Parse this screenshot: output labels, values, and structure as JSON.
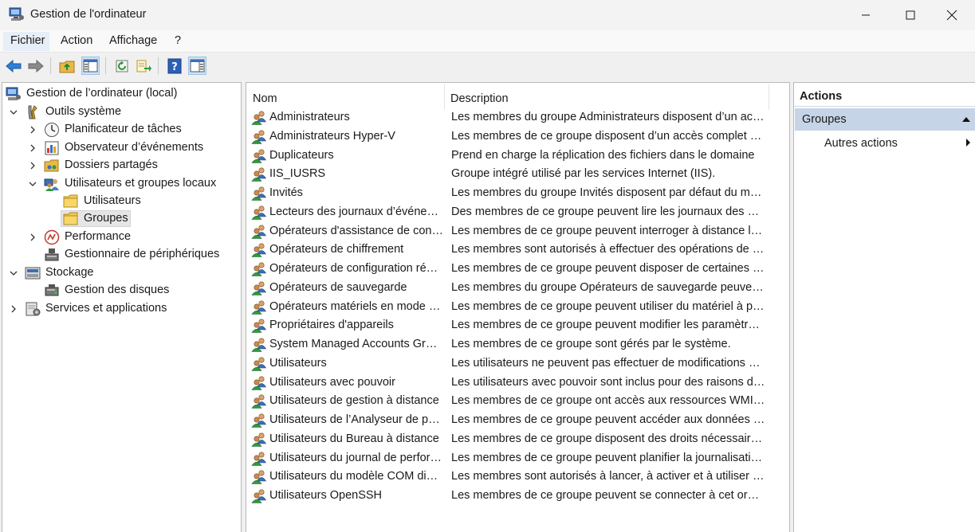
{
  "window": {
    "title": "Gestion de l'ordinateur",
    "controls": [
      "minimize",
      "maximize",
      "close"
    ]
  },
  "menu": [
    "Fichier",
    "Action",
    "Affichage",
    "?"
  ],
  "toolbar": {
    "buttons": [
      "back-icon",
      "forward-icon",
      "up-folder-icon",
      "show-hide-tree-icon",
      "refresh-icon",
      "export-list-icon",
      "help-icon",
      "show-hide-action-pane-icon"
    ]
  },
  "tree": [
    {
      "label": "Gestion de l’ordinateur (local)",
      "icon": "computer-management-icon",
      "level": 0,
      "arrow": "none"
    },
    {
      "label": "Outils système",
      "icon": "system-tools-icon",
      "level": 0,
      "arrow": "expanded"
    },
    {
      "label": "Planificateur de tâches",
      "icon": "task-scheduler-icon",
      "level": 1,
      "arrow": "collapsed"
    },
    {
      "label": "Observateur d’événements",
      "icon": "event-viewer-icon",
      "level": 1,
      "arrow": "collapsed"
    },
    {
      "label": "Dossiers partagés",
      "icon": "shared-folders-icon",
      "level": 1,
      "arrow": "collapsed"
    },
    {
      "label": "Utilisateurs et groupes locaux",
      "icon": "local-users-groups-icon",
      "level": 1,
      "arrow": "expanded"
    },
    {
      "label": "Utilisateurs",
      "icon": "folder-icon",
      "level": 2,
      "arrow": "none"
    },
    {
      "label": "Groupes",
      "icon": "folder-icon",
      "level": 2,
      "arrow": "none",
      "selected": true
    },
    {
      "label": "Performance",
      "icon": "performance-icon",
      "level": 1,
      "arrow": "collapsed"
    },
    {
      "label": "Gestionnaire de périphériques",
      "icon": "device-manager-icon",
      "level": 1,
      "arrow": "none"
    },
    {
      "label": "Stockage",
      "icon": "storage-icon",
      "level": 0,
      "arrow": "expanded"
    },
    {
      "label": "Gestion des disques",
      "icon": "disk-management-icon",
      "level": 1,
      "arrow": "none"
    },
    {
      "label": "Services et applications",
      "icon": "services-applications-icon",
      "level": 0,
      "arrow": "collapsed"
    }
  ],
  "list": {
    "columns": {
      "name": "Nom",
      "description": "Description"
    },
    "rows": [
      {
        "name": "Administrateurs",
        "description": "Les membres du groupe Administrateurs disposent d’un accès complet et illimité à l’ordinateur/domaine"
      },
      {
        "name": "Administrateurs Hyper-V",
        "description": "Les membres de ce groupe disposent d’un accès complet et illimité à toutes les fonctionnalités d’Hyper-V."
      },
      {
        "name": "Duplicateurs",
        "description": "Prend en charge la réplication des fichiers dans le domaine"
      },
      {
        "name": "IIS_IUSRS",
        "description": "Groupe intégré utilisé par les services Internet (IIS)."
      },
      {
        "name": "Invités",
        "description": "Les membres du groupe Invités disposent par défaut du même accès que les membres du groupe Utilisateurs"
      },
      {
        "name": "Lecteurs des journaux d’événements",
        "description": "Des membres de ce groupe peuvent lire les journaux des événements de l’ordinateur local"
      },
      {
        "name": "Opérateurs d'assistance de contrôle d'accès",
        "description": "Les membres de ce groupe peuvent interroger à distance les attributs d’autorisation"
      },
      {
        "name": "Opérateurs de chiffrement",
        "description": "Les membres sont autorisés à effectuer des opérations de chiffrement."
      },
      {
        "name": "Opérateurs de configuration réseau",
        "description": "Les membres de ce groupe peuvent disposer de certaines autorisations d’administration"
      },
      {
        "name": "Opérateurs de sauvegarde",
        "description": "Les membres du groupe Opérateurs de sauvegarde peuvent passer outre les restrictions de sécurité"
      },
      {
        "name": "Opérateurs matériels en mode distant",
        "description": "Les membres de ce groupe peuvent utiliser du matériel à partir d’un emplacement distant"
      },
      {
        "name": "Propriétaires d'appareils",
        "description": "Les membres de ce groupe peuvent modifier les paramètres à l’échelle du système."
      },
      {
        "name": "System Managed Accounts Group",
        "description": "Les membres de ce groupe sont gérés par le système."
      },
      {
        "name": "Utilisateurs",
        "description": "Les utilisateurs ne peuvent pas effectuer de modifications accidentelles ou intentionnelles"
      },
      {
        "name": "Utilisateurs avec pouvoir",
        "description": "Les utilisateurs avec pouvoir sont inclus pour des raisons de compatibilité descendante"
      },
      {
        "name": "Utilisateurs de gestion à distance",
        "description": "Les membres de ce groupe ont accès aux ressources WMI via des protocoles de gestion"
      },
      {
        "name": "Utilisateurs de l’Analyseur de performances",
        "description": "Les membres de ce groupe peuvent accéder aux données des compteurs de performance"
      },
      {
        "name": "Utilisateurs du Bureau à distance",
        "description": "Les membres de ce groupe disposent des droits nécessaires pour ouvrir une session à distance"
      },
      {
        "name": "Utilisateurs du journal de performances",
        "description": "Les membres de ce groupe peuvent planifier la journalisation des compteurs de performance"
      },
      {
        "name": "Utilisateurs du modèle COM distribué",
        "description": "Les membres sont autorisés à lancer, à activer et à utiliser ses objets distribués sur cet ordinateur."
      },
      {
        "name": "Utilisateurs OpenSSH",
        "description": "Les membres de ce groupe peuvent se connecter à cet ordinateur à l’aide de SSH"
      }
    ]
  },
  "actions": {
    "title": "Actions",
    "group": "Groupes",
    "item": "Autres actions"
  },
  "colors": {
    "selection": "#e5e5e5",
    "actions_group_bg": "#c5d4e6",
    "toolbar_active_bg": "#cfe2f6"
  }
}
